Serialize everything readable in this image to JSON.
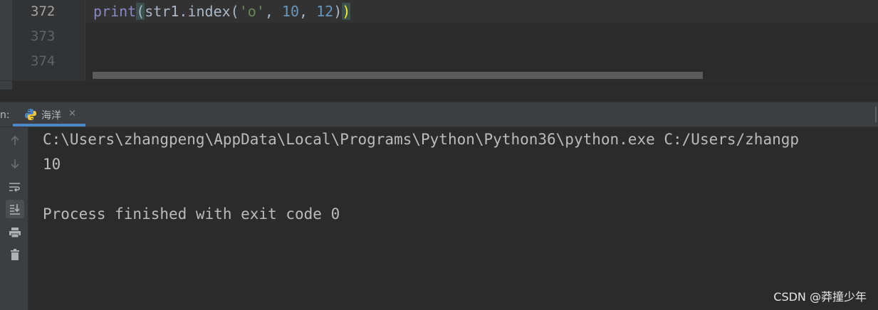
{
  "editor": {
    "line_numbers": [
      "372",
      "373",
      "374"
    ],
    "code": {
      "fn": "print",
      "open_paren": "(",
      "call": "str1.index(",
      "str_arg": "'o'",
      "sep1": ", ",
      "num1": "10",
      "sep2": ", ",
      "num2": "12",
      "close_inner": ")",
      "close_outer": ")"
    }
  },
  "run_panel": {
    "tool_label": "n:",
    "tab_label": "海洋",
    "tab_close": "×",
    "console_lines": [
      "C:\\Users\\zhangpeng\\AppData\\Local\\Programs\\Python\\Python36\\python.exe C:/Users/zhangp",
      "10",
      "",
      "Process finished with exit code 0"
    ],
    "toolbar_icons": [
      "up-arrow-icon",
      "down-arrow-icon",
      "soft-wrap-icon",
      "scroll-to-end-icon",
      "print-icon",
      "trash-icon"
    ]
  },
  "watermark": "CSDN @莽撞少年",
  "colors": {
    "background": "#2b2b2b",
    "gutter": "#313335",
    "tool_header": "#3c3f41",
    "accent_tab": "#4a88c7",
    "code_text": "#a9b7c6",
    "builtin": "#8888c6",
    "string": "#6a8759",
    "number": "#6897bb"
  }
}
